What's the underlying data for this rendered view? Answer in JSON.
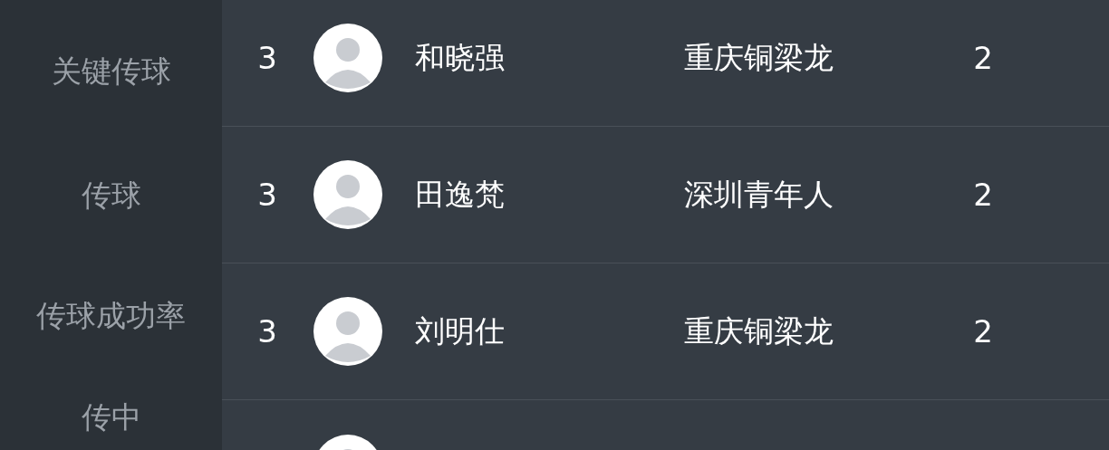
{
  "categories": [
    {
      "label": "关键传球"
    },
    {
      "label": "传球"
    },
    {
      "label": "传球成功率"
    },
    {
      "label": "传中"
    }
  ],
  "rows": [
    {
      "rank": "3",
      "name": "和晓强",
      "team": "重庆铜梁龙",
      "value": "2"
    },
    {
      "rank": "3",
      "name": "田逸梵",
      "team": "深圳青年人",
      "value": "2"
    },
    {
      "rank": "3",
      "name": "刘明仕",
      "team": "重庆铜梁龙",
      "value": "2"
    }
  ]
}
